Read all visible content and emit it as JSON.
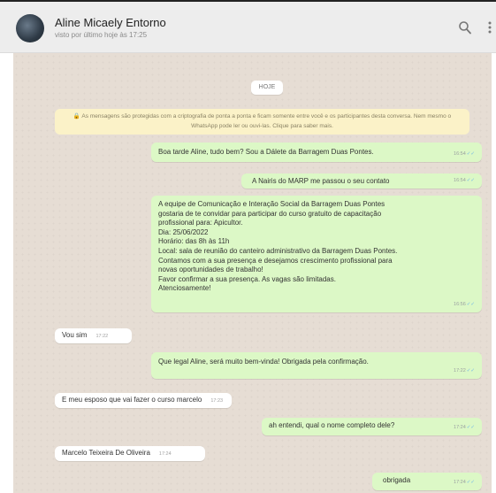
{
  "header": {
    "contact_name": "Aline Micaely Entorno",
    "last_seen": "visto por último hoje às 17:25"
  },
  "chat": {
    "date_chip": "HOJE",
    "encryption_notice": "🔒 As mensagens são protegidas com a criptografia de ponta a ponta e ficam somente entre você e os participantes desta conversa. Nem mesmo o WhatsApp pode ler ou ouvi-las. Clique para saber mais.",
    "messages": [
      {
        "direction": "out",
        "text": "Boa tarde Aline, tudo bem? Sou a Dálete da Barragem Duas Pontes.",
        "time": "16:54"
      },
      {
        "direction": "out",
        "text": "A Nairis do MARP me passou o seu contato",
        "time": "16:54"
      },
      {
        "direction": "out",
        "text": "A equipe de Comunicação e Interação Social da Barragem Duas Pontes\ngostaria de te convidar para participar do curso gratuito de capacitação\nprofissional para: Apicultor.\nDia: 25/06/2022\nHorário: das 8h às 11h\nLocal: sala de reunião do canteiro administrativo da Barragem Duas Pontes.\nContamos com a sua presença e desejamos crescimento profissional para\nnovas oportunidades de trabalho!\nFavor confirmar a sua presença. As vagas são limitadas.\nAtenciosamente!",
        "time": "16:56"
      },
      {
        "direction": "in",
        "text": "Vou sim",
        "time": "17:22"
      },
      {
        "direction": "out",
        "text": "Que legal Aline, será muito bem-vinda! Obrigada pela confirmação.",
        "time": "17:22"
      },
      {
        "direction": "in",
        "text": "E meu esposo que vai fazer o curso marcelo",
        "time": "17:23"
      },
      {
        "direction": "out",
        "text": "ah entendi, qual o nome completo dele?",
        "time": "17:24"
      },
      {
        "direction": "in",
        "text": "Marcelo Teixeira De Oliveira",
        "time": "17:24"
      },
      {
        "direction": "out",
        "text": "obrigada",
        "time": "17:24"
      }
    ]
  },
  "icons": {
    "search": "search-icon",
    "menu": "kebab-menu-icon",
    "lock": "lock-icon",
    "read": "double-check-icon"
  }
}
